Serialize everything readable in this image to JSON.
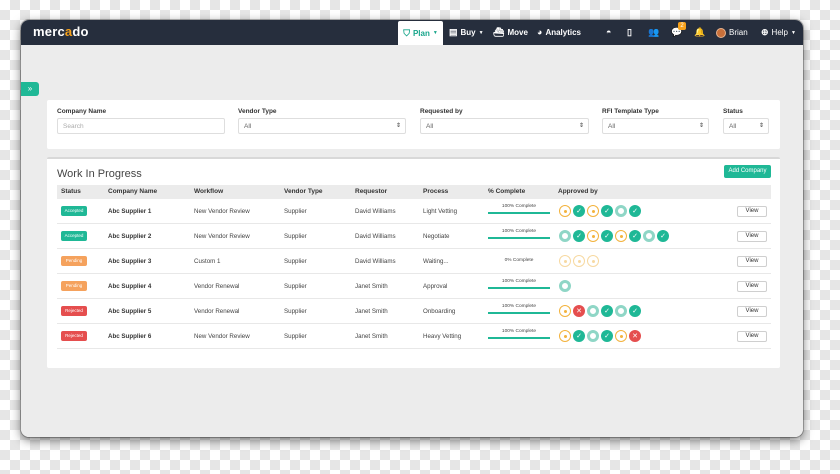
{
  "app": {
    "logo_main": "merc",
    "logo_accent": "a",
    "logo_end": "do"
  },
  "nav": {
    "plan": "Plan",
    "buy": "Buy",
    "move": "Move",
    "analytics": "Analytics",
    "notification_count": "2",
    "user": "Brian",
    "help": "Help"
  },
  "filters": {
    "company_name_label": "Company Name",
    "company_name_placeholder": "Search",
    "vendor_type_label": "Vendor Type",
    "vendor_type_value": "All",
    "requested_by_label": "Requested by",
    "requested_by_value": "All",
    "rfi_label": "RFI Template Type",
    "rfi_value": "All",
    "status_label": "Status",
    "status_value": "All"
  },
  "work": {
    "title": "Work In Progress",
    "add_button": "Add Company",
    "columns": [
      "Status",
      "Company Name",
      "Workflow",
      "Vendor Type",
      "Requestor",
      "Process",
      "% Complete",
      "Approved by"
    ],
    "rows": [
      {
        "status": "Accepted",
        "status_color": "#1fb896",
        "company": "Abc Supplier 1",
        "workflow": "New Vendor Review",
        "vendor_type": "Supplier",
        "requestor": "David Williams",
        "process": "Light Vetting",
        "pct": "100% Complete",
        "bar": true,
        "approvals": [
          "pend",
          "ok",
          "pend",
          "ok",
          "ring",
          "ok"
        ],
        "view": "View"
      },
      {
        "status": "Accepted",
        "status_color": "#1fb896",
        "company": "Abc Supplier 2",
        "workflow": "New Vendor Review",
        "vendor_type": "Supplier",
        "requestor": "David Williams",
        "process": "Negotiate",
        "pct": "100% Complete",
        "bar": true,
        "approvals": [
          "ring",
          "ok",
          "pend",
          "ok",
          "pend",
          "ok",
          "ring",
          "ok"
        ],
        "view": "View"
      },
      {
        "status": "Pending",
        "status_color": "#f5a25d",
        "company": "Abc Supplier 3",
        "workflow": "Custom 1",
        "vendor_type": "Supplier",
        "requestor": "David Williams",
        "process": "Waiting...",
        "pct": "0% Complete",
        "bar": false,
        "approvals": [
          "faint",
          "faint",
          "faint"
        ],
        "view": "View"
      },
      {
        "status": "Pending",
        "status_color": "#f5a25d",
        "company": "Abc Supplier 4",
        "workflow": "Vendor Renewal",
        "vendor_type": "Supplier",
        "requestor": "Janet Smith",
        "process": "Approval",
        "pct": "100% Complete",
        "bar": true,
        "approvals": [
          "ring"
        ],
        "view": "View"
      },
      {
        "status": "Rejected",
        "status_color": "#e54e4e",
        "company": "Abc Supplier 5",
        "workflow": "Vendor Renewal",
        "vendor_type": "Supplier",
        "requestor": "Janet Smith",
        "process": "Onboarding",
        "pct": "100% Complete",
        "bar": true,
        "approvals": [
          "pend",
          "no",
          "ring",
          "ok",
          "ring",
          "ok"
        ],
        "view": "View"
      },
      {
        "status": "Rejected",
        "status_color": "#e54e4e",
        "company": "Abc Supplier 6",
        "workflow": "New Vendor Review",
        "vendor_type": "Supplier",
        "requestor": "Janet Smith",
        "process": "Heavy Vetting",
        "pct": "100% Complete",
        "bar": true,
        "approvals": [
          "pend",
          "ok",
          "ring",
          "ok",
          "pend",
          "no"
        ],
        "view": "View"
      }
    ]
  },
  "colors": {
    "accent": "#1fb896",
    "topbar": "#262e3d",
    "orange": "#f6a11b"
  }
}
